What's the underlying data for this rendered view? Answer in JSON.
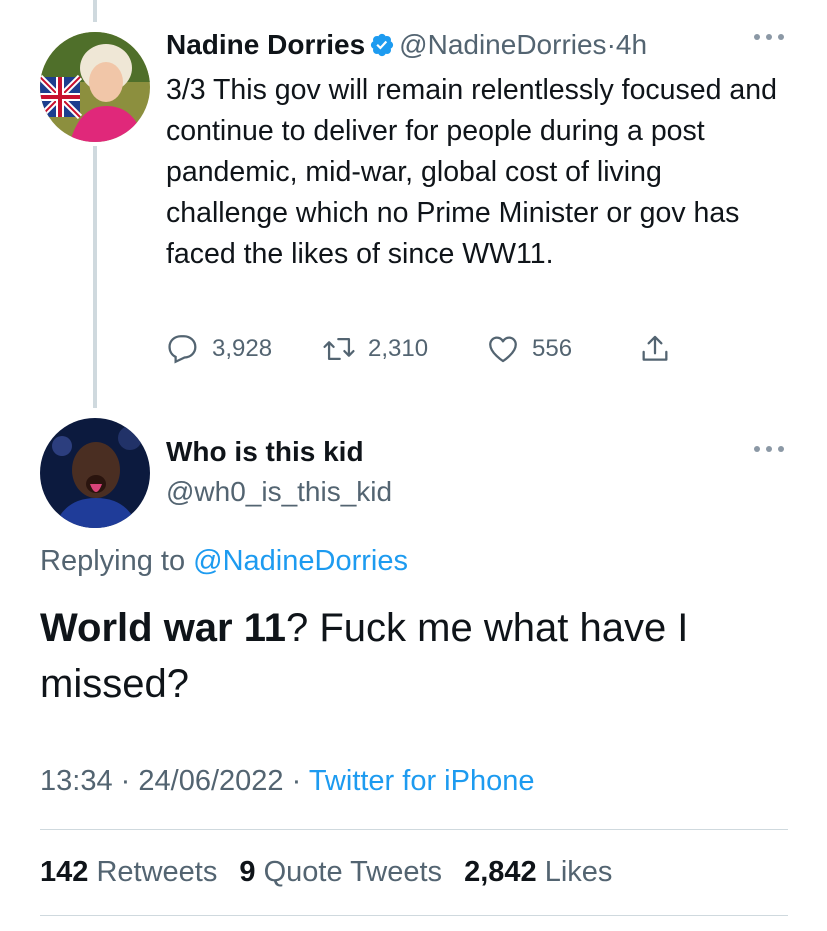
{
  "tweet1": {
    "display_name": "Nadine Dorries",
    "handle": "@NadineDorries",
    "separator": "·",
    "time": "4h",
    "text": "3/3 This gov will remain relentlessly focused and continue to deliver for people during a post pandemic, mid-war, global cost of living challenge which no Prime Minister or gov has faced the likes of since WW11.",
    "replies": "3,928",
    "retweets": "2,310",
    "likes": "556"
  },
  "tweet2": {
    "display_name": "Who is this kid",
    "handle": "@wh0_is_this_kid",
    "replying_prefix": "Replying to",
    "replying_to": "@NadineDorries",
    "text_bold": "World war 11",
    "text_rest": "? Fuck me what have I missed?",
    "time": "13:34",
    "date": "24/06/2022",
    "separator": "·",
    "source": "Twitter for iPhone",
    "retweets_count": "142",
    "retweets_label": "Retweets",
    "quote_count": "9",
    "quote_label": "Quote Tweets",
    "likes_count": "2,842",
    "likes_label": "Likes"
  },
  "icons": {
    "verified": "verified-badge-icon",
    "more": "more-dots-icon",
    "reply": "reply-icon",
    "retweet": "retweet-icon",
    "like": "heart-icon",
    "share": "share-icon"
  },
  "colors": {
    "link": "#1d9bf0",
    "secondary_text": "#536471",
    "primary_text": "#0f1419",
    "divider": "#cfd9de"
  }
}
